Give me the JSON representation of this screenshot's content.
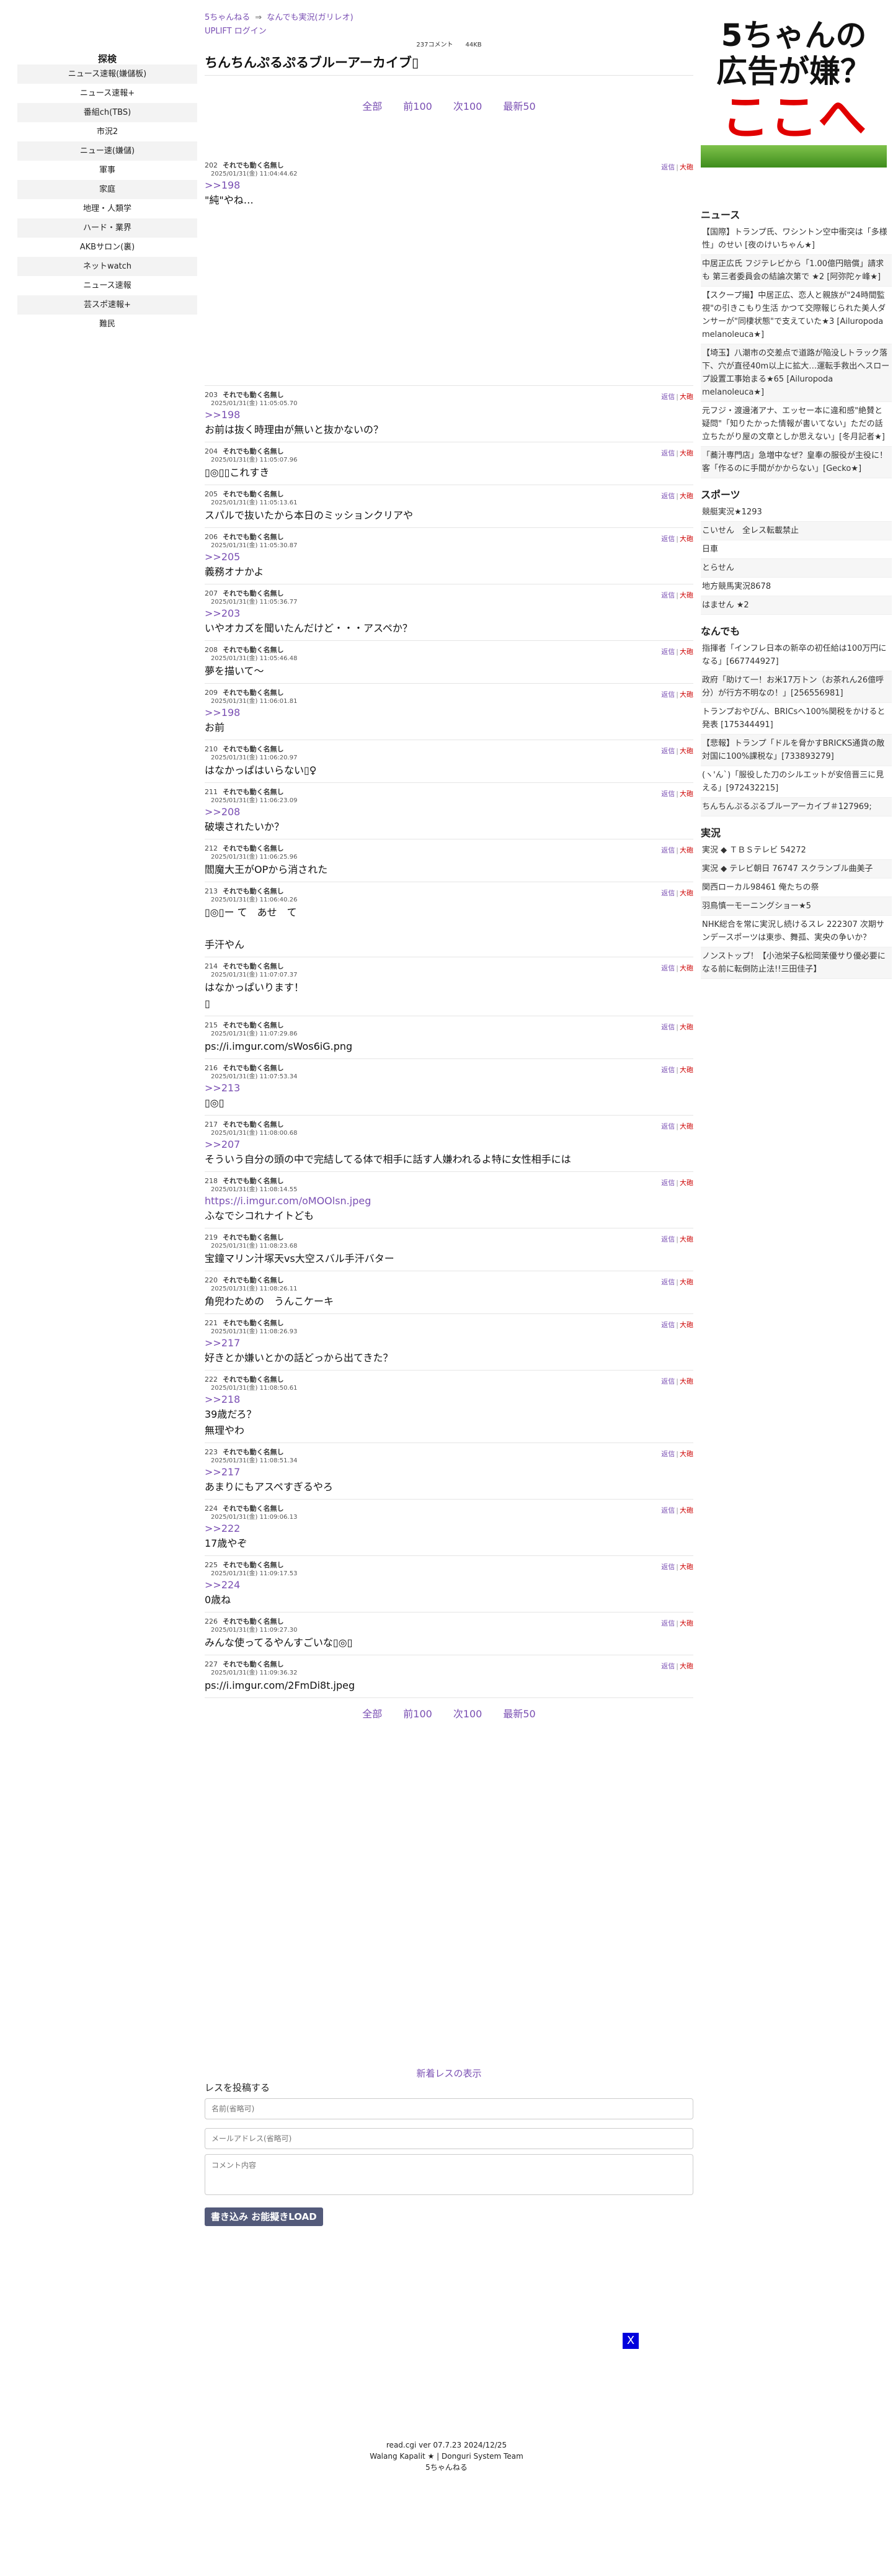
{
  "nav": {
    "title": "探検",
    "items": [
      "ニュース速報(嫌儲板)",
      "ニュース速報+",
      "番組ch(TBS)",
      "市況2",
      "ニュー速(嫌儲)",
      "軍事",
      "家庭",
      "地理・人類学",
      "ハード・業界",
      "AKBサロン(裏)",
      "ネットwatch",
      "ニュース速報",
      "芸スポ速報+",
      "難民"
    ]
  },
  "header": {
    "crumb_home": "5ちゃんねる",
    "crumb_arrow": "⇒",
    "crumb_board": "なんでも実況(ガリレオ)",
    "login": "UPLIFT ログイン",
    "comments": "237コメント",
    "size": "44KB",
    "title": "ちんちんぷるぷるブルーアーカイブ▯"
  },
  "pager": {
    "all": "全部",
    "prev": "前100",
    "next": "次100",
    "last": "最新50"
  },
  "actions": {
    "reply": "返信",
    "sep": "|",
    "big": "大砲"
  },
  "posts": [
    {
      "num": "202",
      "name": "それでも動く名無し",
      "date": "2025/01/31(金) 11:04:44.62",
      "anchor": ">>198",
      "body": "\"純\"やね…"
    },
    {
      "num": "203",
      "name": "それでも動く名無し",
      "date": "2025/01/31(金) 11:05:05.70",
      "anchor": ">>198",
      "body": "お前は抜く時理由が無いと抜かないの？"
    },
    {
      "num": "204",
      "name": "それでも動く名無し",
      "date": "2025/01/31(金) 11:05:07.96",
      "anchor": "",
      "body": "▯◎▯▯これすき"
    },
    {
      "num": "205",
      "name": "それでも動く名無し",
      "date": "2025/01/31(金) 11:05:13.61",
      "anchor": "",
      "body": "スパルで抜いたから本日のミッションクリアや"
    },
    {
      "num": "206",
      "name": "それでも動く名無し",
      "date": "2025/01/31(金) 11:05:30.87",
      "anchor": ">>205",
      "body": "義務オナかよ"
    },
    {
      "num": "207",
      "name": "それでも動く名無し",
      "date": "2025/01/31(金) 11:05:36.77",
      "anchor": ">>203",
      "body": "いやオカズを聞いたんだけど・・・アスペか？"
    },
    {
      "num": "208",
      "name": "それでも動く名無し",
      "date": "2025/01/31(金) 11:05:46.48",
      "anchor": "",
      "body": "夢を描いて〜"
    },
    {
      "num": "209",
      "name": "それでも動く名無し",
      "date": "2025/01/31(金) 11:06:01.81",
      "anchor": ">>198",
      "body": "お前"
    },
    {
      "num": "210",
      "name": "それでも動く名無し",
      "date": "2025/01/31(金) 11:06:20.97",
      "anchor": "",
      "body": "はなかっぱはいらない▯♀"
    },
    {
      "num": "211",
      "name": "それでも動く名無し",
      "date": "2025/01/31(金) 11:06:23.09",
      "anchor": ">>208",
      "body": "破壊されたいか？"
    },
    {
      "num": "212",
      "name": "それでも動く名無し",
      "date": "2025/01/31(金) 11:06:25.96",
      "anchor": "",
      "body": "閻魔大王がOPから消された"
    },
    {
      "num": "213",
      "name": "それでも動く名無し",
      "date": "2025/01/31(金) 11:06:40.26",
      "anchor": "",
      "body": "▯◎▯ー て　あせ　て\n\n手汗やん"
    },
    {
      "num": "214",
      "name": "それでも動く名無し",
      "date": "2025/01/31(金) 11:07:07.37",
      "anchor": "",
      "body": "はなかっぱいります！\n▯"
    },
    {
      "num": "215",
      "name": "それでも動く名無し",
      "date": "2025/01/31(金) 11:07:29.86",
      "anchor": "",
      "body": "ps://i.imgur.com/sWos6iG.png"
    },
    {
      "num": "216",
      "name": "それでも動く名無し",
      "date": "2025/01/31(金) 11:07:53.34",
      "anchor": ">>213",
      "body": "▯◎▯"
    },
    {
      "num": "217",
      "name": "それでも動く名無し",
      "date": "2025/01/31(金) 11:08:00.68",
      "anchor": ">>207",
      "body": "そういう自分の頭の中で完結してる体で相手に話す人嫌われるよ特に女性相手には"
    },
    {
      "num": "218",
      "name": "それでも動く名無し",
      "date": "2025/01/31(金) 11:08:14.55",
      "anchor": "",
      "link": "https://i.imgur.com/oMOOlsn.jpeg",
      "body": "ふなでシコれナイトども"
    },
    {
      "num": "219",
      "name": "それでも動く名無し",
      "date": "2025/01/31(金) 11:08:23.68",
      "anchor": "",
      "body": "宝鐘マリン汁塚天vs大空スバル手汗バター"
    },
    {
      "num": "220",
      "name": "それでも動く名無し",
      "date": "2025/01/31(金) 11:08:26.11",
      "anchor": "",
      "body": "角兜わための　うんこケーキ"
    },
    {
      "num": "221",
      "name": "それでも動く名無し",
      "date": "2025/01/31(金) 11:08:26.93",
      "anchor": ">>217",
      "body": "好きとか嫌いとかの話どっから出てきた？"
    },
    {
      "num": "222",
      "name": "それでも動く名無し",
      "date": "2025/01/31(金) 11:08:50.61",
      "anchor": ">>218",
      "body": "39歳だろ？\n無理やわ"
    },
    {
      "num": "223",
      "name": "それでも動く名無し",
      "date": "2025/01/31(金) 11:08:51.34",
      "anchor": ">>217",
      "body": "あまりにもアスペすぎるやろ"
    },
    {
      "num": "224",
      "name": "それでも動く名無し",
      "date": "2025/01/31(金) 11:09:06.13",
      "anchor": ">>222",
      "body": "17歳やぞ"
    },
    {
      "num": "225",
      "name": "それでも動く名無し",
      "date": "2025/01/31(金) 11:09:17.53",
      "anchor": ">>224",
      "body": "0歳ね"
    },
    {
      "num": "226",
      "name": "それでも動く名無し",
      "date": "2025/01/31(金) 11:09:27.30",
      "anchor": "",
      "body": "みんな使ってるやんすごいな▯◎▯"
    },
    {
      "num": "227",
      "name": "それでも動く名無し",
      "date": "2025/01/31(金) 11:09:36.32",
      "anchor": "",
      "body": "ps://i.imgur.com/2FmDi8t.jpeg"
    }
  ],
  "ad": {
    "line1": "5ちゃんの",
    "line2": "広告が嫌？",
    "line3": "ここへ"
  },
  "right": {
    "news_title": "ニュース",
    "news": [
      "【国際】トランプ氏、ワシントン空中衝突は「多様性」のせい [夜のけいちゃん★]",
      "中居正広氏 フジテレビから「1.00億円賠償」請求も 第三者委員会の結論次第で ★2 [阿弥陀ヶ峰★]",
      "【スクープ撮】中居正広、恋人と親族が\"24時間監視\"の引きこもり生活 かつて交際報じられた美人ダンサーが\"同棲状態\"で支えていた★3 [Ailuropoda melanoleuca★]",
      "【埼玉】八潮市の交差点で道路が陥没しトラック落下、穴が直径40m以上に拡大…運転手救出へスロープ設置工事始まる★65 [Ailuropoda melanoleuca★]",
      "元フジ・渡邊渚アナ、エッセー本に違和感\"絶賛と疑問\"「知りたかった情報が書いてない」ただの話立ちたがり屋の文章としか思えない」[冬月記者★]",
      "「蕎汁専門店」急増中なぜ？皇奉の服役が主役に！客「作るのに手間がかからない」[Gecko★]"
    ],
    "sports_title": "スポーツ",
    "sports": [
      "競艇実況★1293",
      "こいせん　全レス転載禁止",
      "日車",
      "とらせん",
      "地方競馬実況8678",
      "はません ★2"
    ],
    "any_title": "なんでも",
    "any": [
      "指揮者「インフレ日本の新卒の初任給は100万円になる」[667744927]",
      "政府「助けて一！お米17万トン（お茶れん26億呼分）が行方不明なの！」[256556981]",
      "トランプおやびん、BRICsへ100%関税をかけると発表 [175344491]",
      "【悲報】トランプ「ドルを脅かすBRICKS通貨の敵対国に100%課税な」[733893279]",
      "(ヽ'ん`)「服役した刀のシルエットが安倍晋三に見える」[972432215]",
      "ちんちんぷるぷるブルーアーカイブ＃127969;"
    ],
    "live_title": "実況",
    "live": [
      "実況 ◆ ＴＢＳテレビ 54272",
      "実況 ◆ テレビ朝日 76747 スクランブル曲美子",
      "関西ローカル98461 俺たちの祭",
      "羽鳥慎一モーニングショー★5",
      "NHK総合を常に実況し続けるスレ 222307 次期サンデースポーツは東歩、舞孤、実央の争いか？",
      "ノンストップ！【小池栄子&松岡茉優サり優必要になる前に転倒防止法!!三田佳子】"
    ]
  },
  "form": {
    "new_posts": "新着レスの表示",
    "title": "レスを投稿する",
    "name_ph": "名前(省略可)",
    "mail_ph": "メールアドレス(省略可)",
    "comment_ph": "コメント内容",
    "submit": "書き込み",
    "load": "お能擬きLOAD",
    "close": "X"
  },
  "footer": {
    "line1": "read.cgi ver 07.7.23 2024/12/25",
    "line2": "Walang Kapalit ★ | Donguri System Team",
    "line3": "5ちゃんねる"
  }
}
